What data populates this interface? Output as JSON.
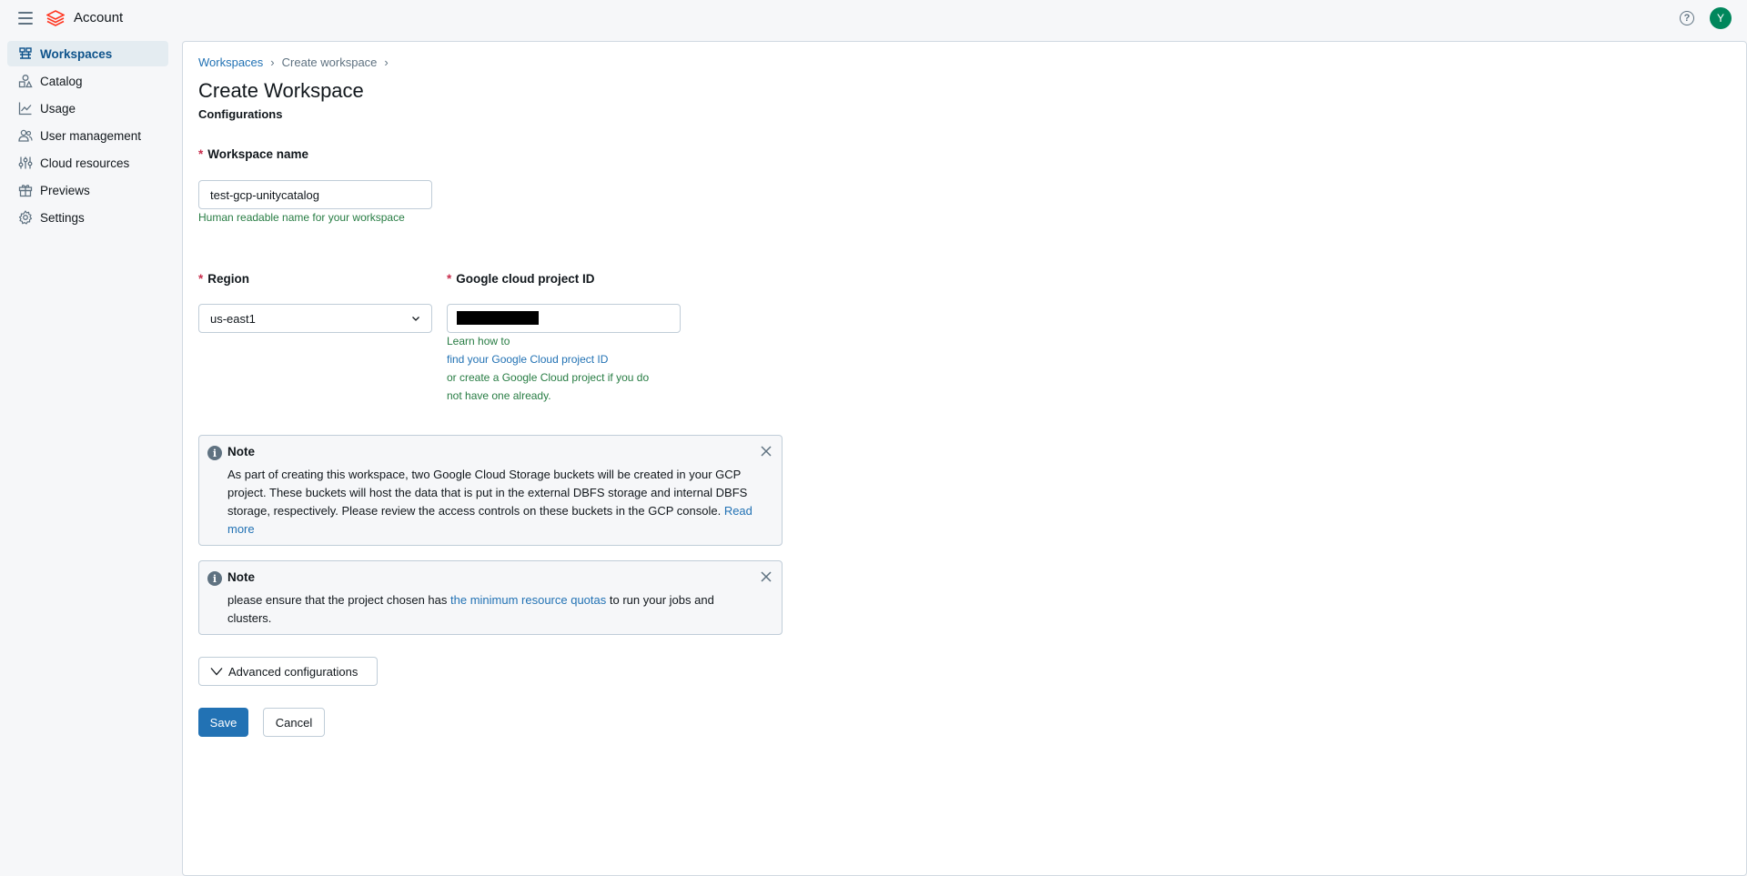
{
  "header": {
    "app_title": "Account",
    "avatar_initial": "Y",
    "help_glyph": "?",
    "icons": [
      "menu-icon",
      "databricks-logo-icon",
      "help-icon"
    ]
  },
  "sidebar": {
    "items": [
      {
        "label": "Workspaces",
        "icon": "workspaces-icon",
        "active": true
      },
      {
        "label": "Catalog",
        "icon": "catalog-icon",
        "active": false
      },
      {
        "label": "Usage",
        "icon": "usage-chart-icon",
        "active": false
      },
      {
        "label": "User management",
        "icon": "users-icon",
        "active": false
      },
      {
        "label": "Cloud resources",
        "icon": "sliders-icon",
        "active": false
      },
      {
        "label": "Previews",
        "icon": "gift-icon",
        "active": false
      },
      {
        "label": "Settings",
        "icon": "gear-icon",
        "active": false
      }
    ]
  },
  "breadcrumb": {
    "items": [
      "Workspaces",
      "Create workspace"
    ],
    "separator": "›"
  },
  "page": {
    "title": "Create Workspace",
    "section": "Configurations"
  },
  "form": {
    "workspace_name": {
      "label": "Workspace name",
      "required_mark": "*",
      "value": "test-gcp-unitycatalog",
      "hint": "Human readable name for your workspace"
    },
    "region": {
      "label": "Region",
      "required_mark": "*",
      "value": "us-east1"
    },
    "gcp_project_id": {
      "label": "Google cloud project ID",
      "required_mark": "*",
      "value": "",
      "hint_prefix": "Learn how to",
      "hint_link": "find your Google Cloud project ID",
      "hint_line3": "or create a Google Cloud project if you do",
      "hint_line4": "not have one already."
    }
  },
  "notes": [
    {
      "title": "Note",
      "body": "As part of creating this workspace, two Google Cloud Storage buckets will be created in your GCP project. These buckets will host the data that is put in the external DBFS storage and internal DBFS storage, respectively. Please review the access controls on these buckets in the GCP console.",
      "link": "Read more"
    },
    {
      "title": "Note",
      "body_before": "please ensure that the project chosen has",
      "link": "the minimum resource quotas",
      "body_after": "to run your jobs and clusters."
    }
  ],
  "advanced": {
    "label": "Advanced configurations"
  },
  "actions": {
    "save": "Save",
    "cancel": "Cancel"
  },
  "colors": {
    "primary": "#2272b4",
    "hint_green": "#277c43",
    "required_red": "#c82d4c",
    "avatar_green": "#00875c",
    "logo_red": "#ff3621"
  }
}
